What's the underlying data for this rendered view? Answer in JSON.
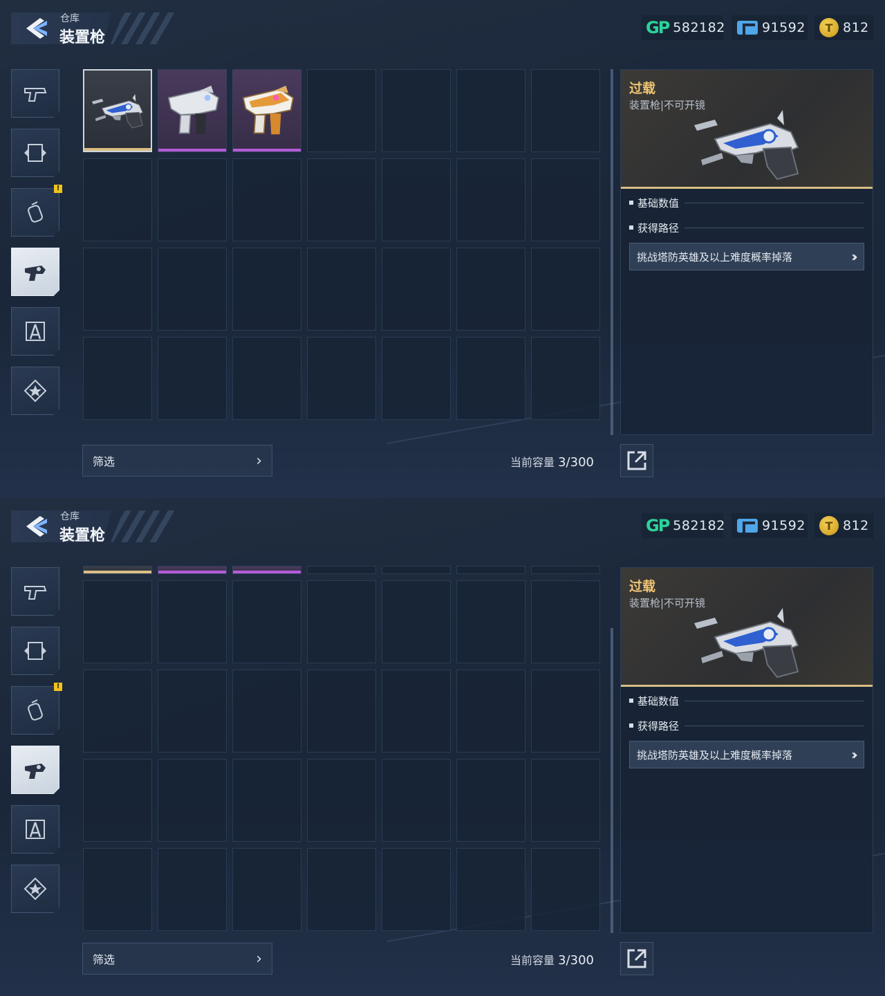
{
  "header": {
    "breadcrumb": "仓库",
    "title": "装置枪"
  },
  "currencies": [
    {
      "icon": "gp-icon",
      "label": "GP",
      "value": "582182"
    },
    {
      "icon": "tm-currency-icon",
      "value": "91592"
    },
    {
      "icon": "gold-coin-icon",
      "glyph": "T",
      "value": "812"
    }
  ],
  "categories": [
    {
      "icon": "pistol-icon",
      "active": false
    },
    {
      "icon": "frame-icon",
      "active": false
    },
    {
      "icon": "grenade-icon",
      "active": false,
      "badge": "!"
    },
    {
      "icon": "device-gun-icon",
      "active": true
    },
    {
      "icon": "compass-icon",
      "active": false
    },
    {
      "icon": "star-badge-icon",
      "active": false
    }
  ],
  "inventory": {
    "items": [
      {
        "slot": 1,
        "rarity": "gold",
        "selected": true
      },
      {
        "slot": 2,
        "rarity": "purple",
        "selected": false
      },
      {
        "slot": 3,
        "rarity": "purple",
        "selected": false
      }
    ]
  },
  "detail": {
    "name": "过载",
    "subtitle": "装置枪|不可开镜",
    "sections": {
      "base_stats": "基础数值",
      "acquisition": "获得路径"
    },
    "route": "挑战塔防英雄及以上难度概率掉落"
  },
  "footer": {
    "filter_label": "筛选",
    "capacity_label": "当前容量",
    "capacity_value": "3/300"
  },
  "colors": {
    "accent_gold": "#d9bf84",
    "name_gold": "#f0c674",
    "rarity_purple": "#b45cd8",
    "gp_green": "#2dd39a",
    "tm_blue": "#4fa6e8"
  }
}
